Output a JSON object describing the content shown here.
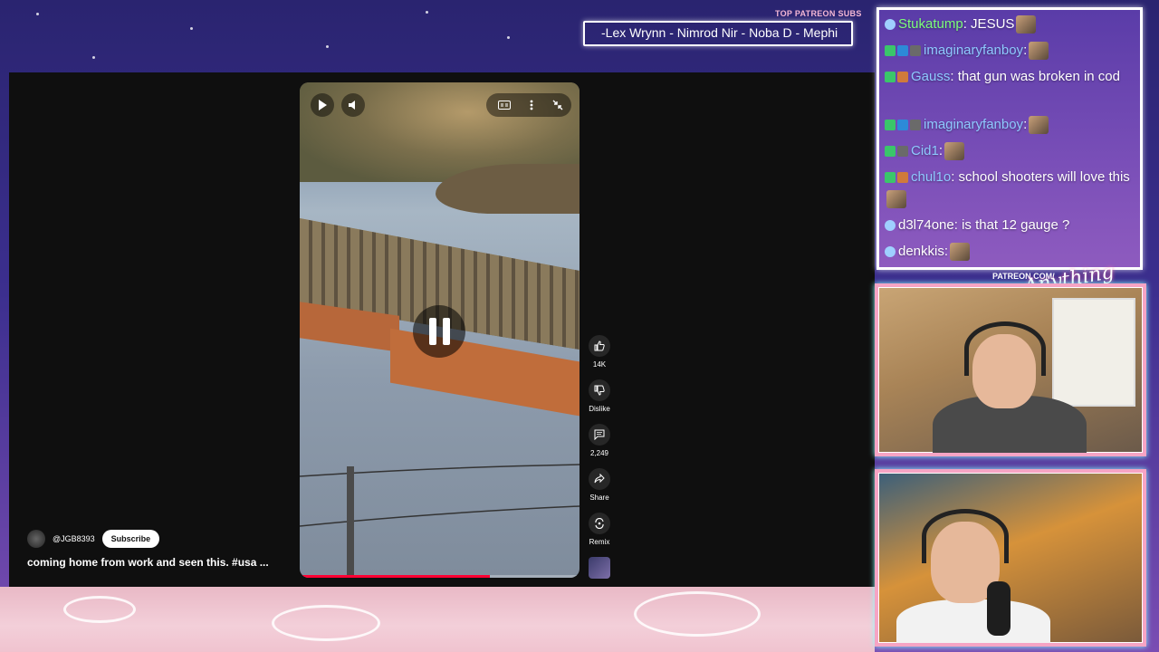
{
  "overlay": {
    "patreon_subs_label": "TOP PATREON SUBS",
    "patreon_subs_ticker": "-Lex Wrynn - Nimrod Nir - Noba D - Mephi",
    "patreon_url": "PATREON.COM/",
    "logo_text": "Anything else?"
  },
  "short": {
    "channel": "@JGB8393",
    "subscribe_label": "Subscribe",
    "title": "coming home from work and seen this. #usa ...",
    "progress": 0.68,
    "actions": [
      {
        "icon": "thumbs-up-icon",
        "label": "14K"
      },
      {
        "icon": "thumbs-down-icon",
        "label": "Dislike"
      },
      {
        "icon": "comment-icon",
        "label": "2,249"
      },
      {
        "icon": "share-icon",
        "label": "Share"
      },
      {
        "icon": "remix-icon",
        "label": "Remix"
      }
    ]
  },
  "chat": [
    {
      "badges": [
        "dot"
      ],
      "user": "Stukatump",
      "color": "#7CFF7A",
      "message": " JESUS",
      "emote": true
    },
    {
      "badges": [
        "mod",
        "vip",
        "sub"
      ],
      "user": "imaginaryfanboy",
      "color": "#8EC9FF",
      "message": "",
      "emote": true
    },
    {
      "badges": [
        "mod",
        "gift"
      ],
      "user": "Gauss",
      "color": "#8EC9FF",
      "message": " that gun was broken in cod",
      "emote": false
    },
    {
      "badges": [
        "mod",
        "vip",
        "sub"
      ],
      "user": "imaginaryfanboy",
      "color": "#8EC9FF",
      "message": "",
      "emote": true
    },
    {
      "badges": [
        "mod",
        "sub"
      ],
      "user": "Cid1",
      "color": "#8EC9FF",
      "message": "",
      "emote": true
    },
    {
      "badges": [
        "mod",
        "gift"
      ],
      "user": "chul1o",
      "color": "#8EC9FF",
      "message": " school shooters will love this",
      "emote": true
    },
    {
      "badges": [
        "dot"
      ],
      "user": "d3l74one",
      "color": "#FFFFFF",
      "message": " is that 12 gauge ?",
      "emote": false
    },
    {
      "badges": [
        "dot"
      ],
      "user": "denkkis",
      "color": "#FFFFFF",
      "message": "",
      "emote": true
    }
  ]
}
